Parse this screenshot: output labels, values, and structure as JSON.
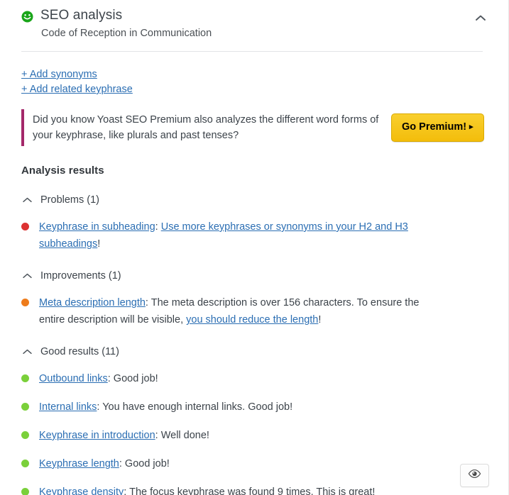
{
  "header": {
    "icon": "smiley-face-green-icon",
    "title": "SEO analysis",
    "subtitle": "Code of Reception in Communication",
    "toggle_icon": "chevron-up-icon"
  },
  "add_links": [
    {
      "label": "+ Add synonyms",
      "name": "add-synonyms-link"
    },
    {
      "label": "+ Add related keyphrase",
      "name": "add-related-keyphrase-link"
    }
  ],
  "premium_banner": {
    "accent_color": "#a4286a",
    "message": "Did you know Yoast SEO Premium also analyzes the different word forms of your keyphrase, like plurals and past tenses?",
    "button_label": "Go Premium!",
    "button_arrow": "▸",
    "button_color": "#f5c200"
  },
  "results": {
    "heading": "Analysis results",
    "sections": [
      {
        "name": "problems",
        "label": "Problems (1)",
        "chevron": "chevron-up-icon",
        "dot_color": "#dc3232",
        "severity": "bad",
        "items": [
          {
            "link_label": "Keyphrase in subheading",
            "separator": ": ",
            "body_link": "Use more keyphrases or synonyms in your H2 and H3 subheadings",
            "tail": "!"
          }
        ]
      },
      {
        "name": "improvements",
        "label": "Improvements (1)",
        "chevron": "chevron-up-icon",
        "dot_color": "#ee7c1b",
        "severity": "ok",
        "items": [
          {
            "link_label": "Meta description length",
            "separator": ": ",
            "body_before": "The meta description is over 156 characters. To ensure the entire description will be visible, ",
            "body_link": "you should reduce the length",
            "tail": "!"
          }
        ]
      },
      {
        "name": "good-results",
        "label": "Good results (11)",
        "chevron": "chevron-up-icon",
        "dot_color": "#7ad03a",
        "severity": "good",
        "items": [
          {
            "link_label": "Outbound links",
            "separator": ": ",
            "body_before": "Good job!",
            "body_link": "",
            "tail": ""
          },
          {
            "link_label": "Internal links",
            "separator": ": ",
            "body_before": "You have enough internal links. Good job!",
            "body_link": "",
            "tail": ""
          },
          {
            "link_label": "Keyphrase in introduction",
            "separator": ": ",
            "body_before": "Well done!",
            "body_link": "",
            "tail": ""
          },
          {
            "link_label": "Keyphrase length",
            "separator": ": ",
            "body_before": "Good job!",
            "body_link": "",
            "tail": ""
          },
          {
            "link_label": "Keyphrase density",
            "separator": ": ",
            "body_before": "The focus keyphrase was found 9 times. This is great!",
            "body_link": "",
            "tail": ""
          }
        ]
      }
    ]
  },
  "eye_button": {
    "icon": "eye-icon",
    "label": ""
  }
}
